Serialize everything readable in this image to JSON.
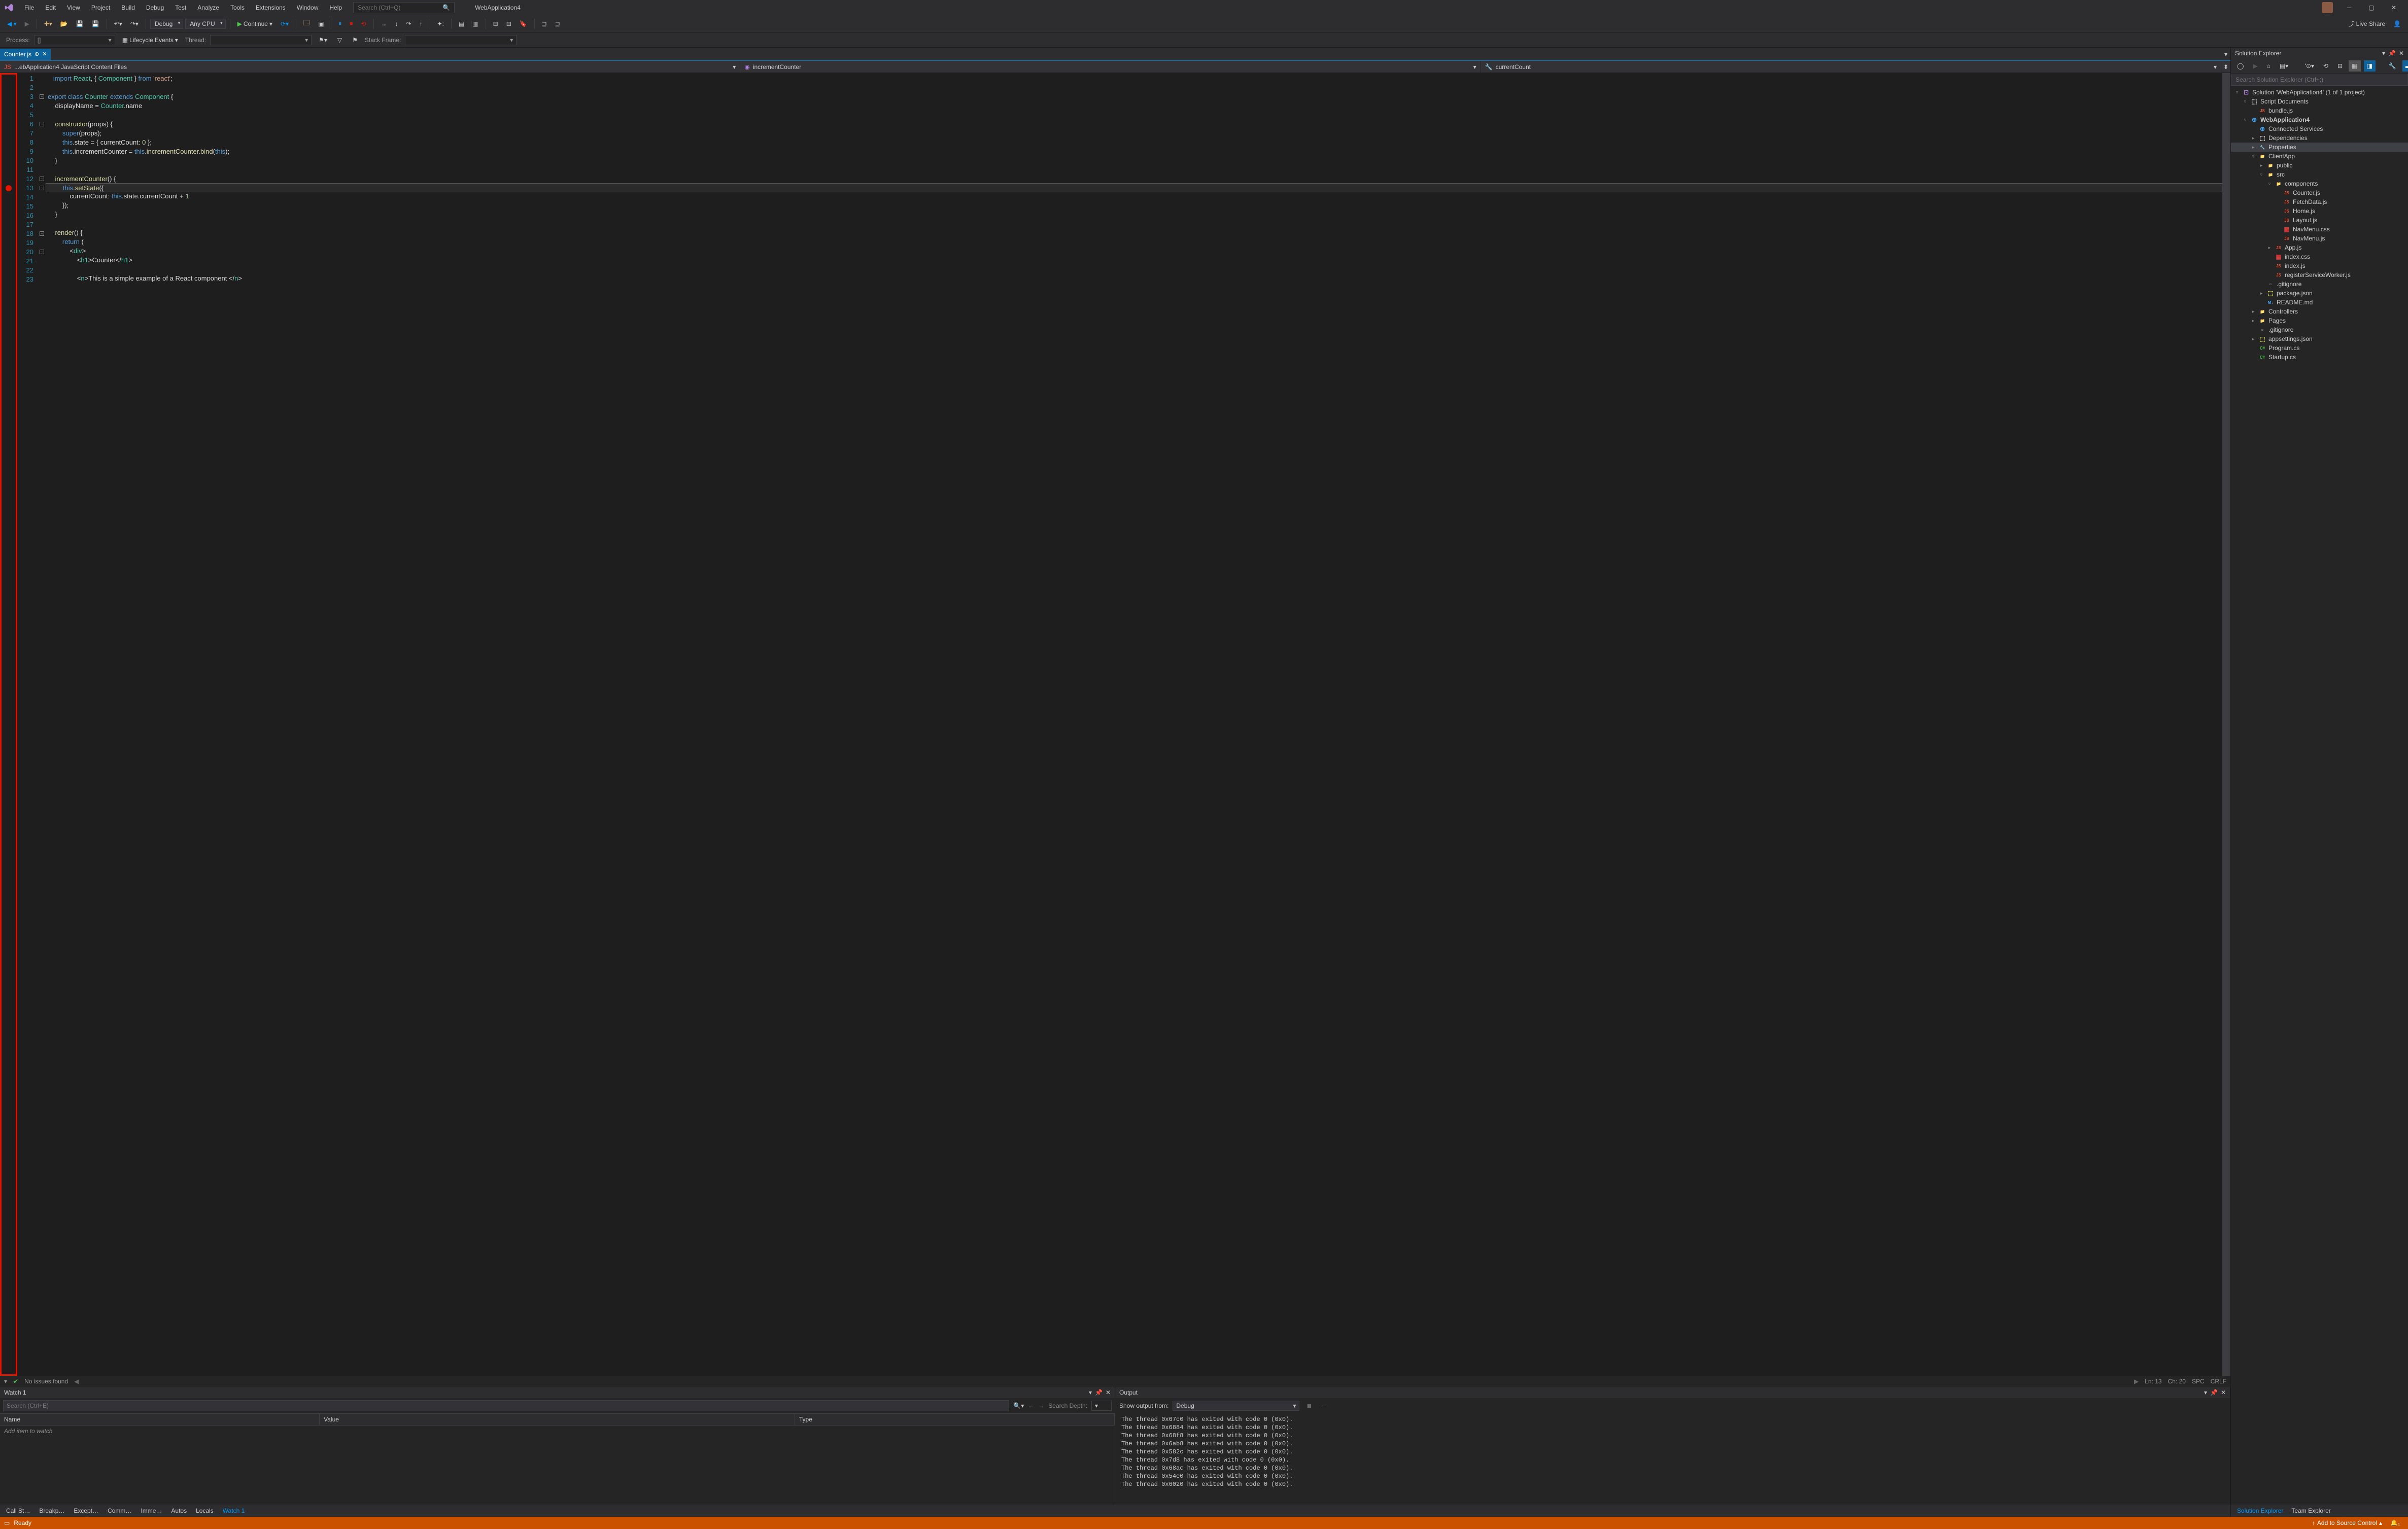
{
  "title": "WebApplication4",
  "menus": [
    "File",
    "Edit",
    "View",
    "Project",
    "Build",
    "Debug",
    "Test",
    "Analyze",
    "Tools",
    "Extensions",
    "Window",
    "Help"
  ],
  "search_placeholder": "Search (Ctrl+Q)",
  "toolbar": {
    "config": "Debug",
    "platform": "Any CPU",
    "continue_label": "Continue",
    "liveshare": "Live Share"
  },
  "toolbar2": {
    "process_label": "Process:",
    "process_value": "[]",
    "lifecycle": "Lifecycle Events",
    "thread": "Thread:",
    "stackframe": "Stack Frame:"
  },
  "tab": {
    "name": "Counter.js"
  },
  "navbar": {
    "scope": "...ebApplication4 JavaScript Content Files",
    "member": "incrementCounter",
    "submember": "currentCount"
  },
  "code": {
    "lines": [
      {
        "n": 1,
        "html": "   <span class='kw'>import</span> <span class='cls'>React</span>, { <span class='cls'>Component</span> } <span class='kw'>from</span> <span class='str'>'react'</span>;"
      },
      {
        "n": 2,
        "html": ""
      },
      {
        "n": 3,
        "fold": "-",
        "html": "<span class='kw'>export</span> <span class='kw'>class</span> <span class='cls'>Counter</span> <span class='kw'>extends</span> <span class='cls'>Component</span> {"
      },
      {
        "n": 4,
        "html": "    displayName = <span class='cls'>Counter</span>.name"
      },
      {
        "n": 5,
        "html": ""
      },
      {
        "n": 6,
        "fold": "-",
        "html": "    <span class='fn'>constructor</span>(props) {"
      },
      {
        "n": 7,
        "html": "        <span class='kw'>super</span>(props);"
      },
      {
        "n": 8,
        "html": "        <span class='kw'>this</span>.state = { currentCount: <span class='num'>0</span> };"
      },
      {
        "n": 9,
        "html": "        <span class='kw'>this</span>.incrementCounter = <span class='kw'>this</span>.<span class='fn'>incrementCounter</span>.<span class='fn'>bind</span>(<span class='kw'>this</span>);"
      },
      {
        "n": 10,
        "html": "    }"
      },
      {
        "n": 11,
        "html": ""
      },
      {
        "n": 12,
        "fold": "-",
        "html": "    <span class='fn'>incrementCounter</span>() {"
      },
      {
        "n": 13,
        "fold": "-",
        "bp": true,
        "cur": true,
        "html": "        <span class='kw'>this</span>.<span class='fn'>setState</span>({"
      },
      {
        "n": 14,
        "html": "            currentCount: <span class='kw'>this</span>.state.currentCount + <span class='num'>1</span>"
      },
      {
        "n": 15,
        "html": "        });"
      },
      {
        "n": 16,
        "html": "    }"
      },
      {
        "n": 17,
        "html": ""
      },
      {
        "n": 18,
        "fold": "-",
        "html": "    <span class='fn'>render</span>() {"
      },
      {
        "n": 19,
        "html": "        <span class='kw'>return</span> ("
      },
      {
        "n": 20,
        "fold": "-",
        "html": "            &lt;<span class='cls'>div</span>&gt;"
      },
      {
        "n": 21,
        "html": "                &lt;<span class='cls'>h1</span>&gt;Counter&lt;/<span class='cls'>h1</span>&gt;"
      },
      {
        "n": 22,
        "html": ""
      },
      {
        "n": 23,
        "html": "                &lt;<span class='cls'>n</span>&gt;This is a simple example of a React component &lt;/<span class='cls'>n</span>&gt;"
      }
    ]
  },
  "status_strip": {
    "issues": "No issues found",
    "ln": "Ln: 13",
    "ch": "Ch: 20",
    "spc": "SPC",
    "eol": "CRLF"
  },
  "watch": {
    "title": "Watch 1",
    "search_placeholder": "Search (Ctrl+E)",
    "depth_label": "Search Depth:",
    "columns": [
      "Name",
      "Value",
      "Type"
    ],
    "placeholder": "Add item to watch"
  },
  "output": {
    "title": "Output",
    "from_label": "Show output from:",
    "source": "Debug",
    "lines": [
      "The thread 0x67c0 has exited with code 0 (0x0).",
      "The thread 0x6884 has exited with code 0 (0x0).",
      "The thread 0x68f8 has exited with code 0 (0x0).",
      "The thread 0x6ab8 has exited with code 0 (0x0).",
      "The thread 0x582c has exited with code 0 (0x0).",
      "The thread 0x7d8 has exited with code 0 (0x0).",
      "The thread 0x68ac has exited with code 0 (0x0).",
      "The thread 0x54e0 has exited with code 0 (0x0).",
      "The thread 0x6020 has exited with code 0 (0x0)."
    ]
  },
  "bottom_tabs": [
    "Call St…",
    "Breakp…",
    "Except…",
    "Comm…",
    "Imme…",
    "Autos",
    "Locals",
    "Watch 1"
  ],
  "bottom_tabs_active": 7,
  "solution": {
    "title": "Solution Explorer",
    "search_placeholder": "Search Solution Explorer (Ctrl+;)",
    "root": "Solution 'WebApplication4' (1 of 1 project)",
    "tabs": [
      "Solution Explorer",
      "Team Explorer"
    ]
  },
  "tree": [
    {
      "d": 0,
      "e": "▿",
      "i": "⊡",
      "c": "#b083d9",
      "t": "Solution 'WebApplication4' (1 of 1 project)"
    },
    {
      "d": 1,
      "e": "▿",
      "i": "⬚",
      "c": "#ccc",
      "t": "Script Documents"
    },
    {
      "d": 2,
      "e": "",
      "i": "JS",
      "c": "#f1502f",
      "t": "bundle.js",
      "cls": "jsfile"
    },
    {
      "d": 1,
      "e": "▿",
      "i": "⊕",
      "c": "#42a5f5",
      "t": "WebApplication4",
      "bold": true
    },
    {
      "d": 2,
      "e": "",
      "i": "⊕",
      "c": "#42a5f5",
      "t": "Connected Services"
    },
    {
      "d": 2,
      "e": "▸",
      "i": "⬚",
      "c": "#ccc",
      "t": "Dependencies"
    },
    {
      "d": 2,
      "e": "▸",
      "i": "🔧",
      "c": "#ccc",
      "t": "Properties",
      "sel": true
    },
    {
      "d": 2,
      "e": "▿",
      "i": "📁",
      "c": "#dcb67a",
      "t": "ClientApp"
    },
    {
      "d": 3,
      "e": "▸",
      "i": "📁",
      "c": "#dcb67a",
      "t": "public"
    },
    {
      "d": 3,
      "e": "▿",
      "i": "📁",
      "c": "#dcb67a",
      "t": "src"
    },
    {
      "d": 4,
      "e": "▿",
      "i": "📁",
      "c": "#dcb67a",
      "t": "components"
    },
    {
      "d": 5,
      "e": "",
      "i": "JS",
      "c": "#f1502f",
      "t": "Counter.js"
    },
    {
      "d": 5,
      "e": "",
      "i": "JS",
      "c": "#f1502f",
      "t": "FetchData.js"
    },
    {
      "d": 5,
      "e": "",
      "i": "JS",
      "c": "#f1502f",
      "t": "Home.js"
    },
    {
      "d": 5,
      "e": "",
      "i": "JS",
      "c": "#f1502f",
      "t": "Layout.js"
    },
    {
      "d": 5,
      "e": "",
      "i": "▦",
      "c": "#d33c3c",
      "t": "NavMenu.css"
    },
    {
      "d": 5,
      "e": "",
      "i": "JS",
      "c": "#f1502f",
      "t": "NavMenu.js"
    },
    {
      "d": 4,
      "e": "▸",
      "i": "JS",
      "c": "#f1502f",
      "t": "App.js"
    },
    {
      "d": 4,
      "e": "",
      "i": "▦",
      "c": "#d33c3c",
      "t": "index.css"
    },
    {
      "d": 4,
      "e": "",
      "i": "JS",
      "c": "#f1502f",
      "t": "index.js"
    },
    {
      "d": 4,
      "e": "",
      "i": "JS",
      "c": "#f1502f",
      "t": "registerServiceWorker.js"
    },
    {
      "d": 3,
      "e": "",
      "i": "▫",
      "c": "#999",
      "t": ".gitignore"
    },
    {
      "d": 3,
      "e": "▸",
      "i": "⬚",
      "c": "#cbcb41",
      "t": "package.json"
    },
    {
      "d": 3,
      "e": "",
      "i": "M↓",
      "c": "#42a5f5",
      "t": "README.md"
    },
    {
      "d": 2,
      "e": "▸",
      "i": "📁",
      "c": "#dcb67a",
      "t": "Controllers"
    },
    {
      "d": 2,
      "e": "▸",
      "i": "📁",
      "c": "#dcb67a",
      "t": "Pages"
    },
    {
      "d": 2,
      "e": "",
      "i": "▫",
      "c": "#999",
      "t": ".gitignore"
    },
    {
      "d": 2,
      "e": "▸",
      "i": "⬚",
      "c": "#cbcb41",
      "t": "appsettings.json"
    },
    {
      "d": 2,
      "e": "",
      "i": "C#",
      "c": "#4ec94e",
      "t": "Program.cs"
    },
    {
      "d": 2,
      "e": "",
      "i": "C#",
      "c": "#4ec94e",
      "t": "Startup.cs"
    }
  ],
  "statusbar": {
    "ready": "Ready",
    "source_control": "Add to Source Control"
  }
}
